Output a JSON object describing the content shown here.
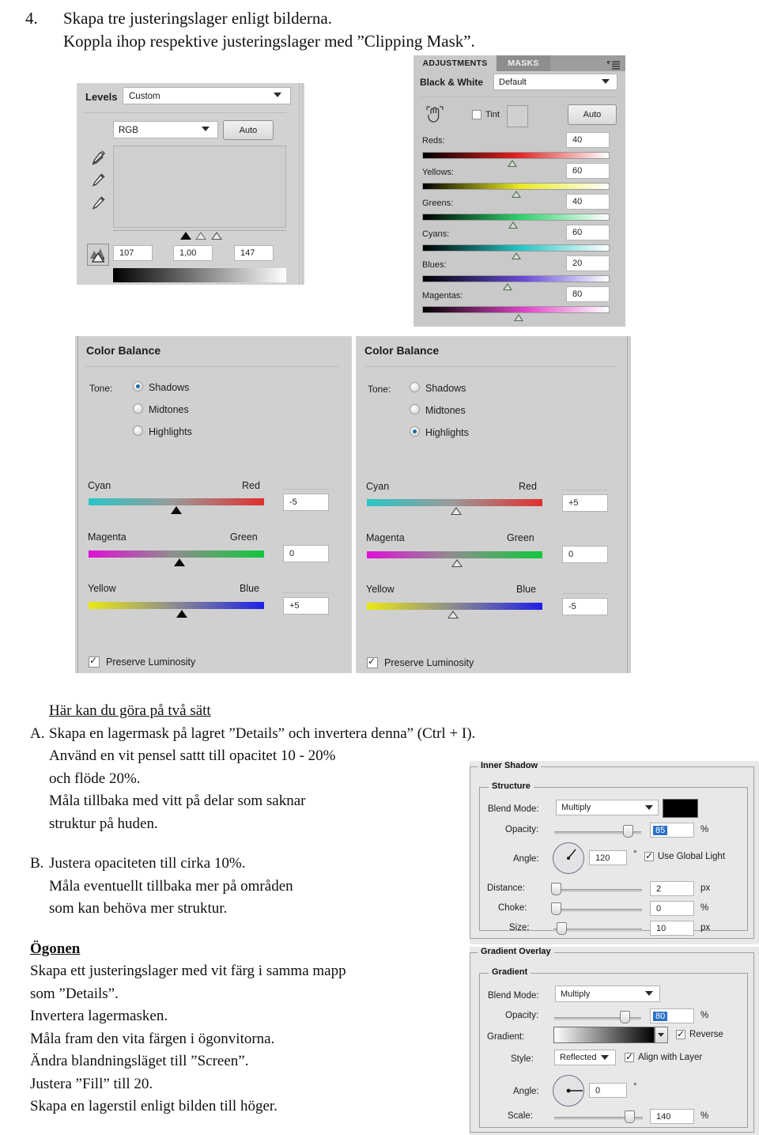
{
  "heading": {
    "number": "4.",
    "line1": "Skapa tre justeringslager enligt bilderna.",
    "line2": "Koppla ihop respektive justeringslager med ”Clipping Mask”."
  },
  "levels_panel": {
    "title": "Levels",
    "preset": "Custom",
    "channel": "RGB",
    "auto_label": "Auto",
    "input_black": "107",
    "gamma": "1,00",
    "input_white": "147",
    "eyedroppers": [
      "black-point-eyedropper",
      "gray-point-eyedropper",
      "white-point-eyedropper"
    ]
  },
  "adjustments_panel": {
    "tabs": [
      {
        "label": "ADJUSTMENTS",
        "active": true
      },
      {
        "label": "MASKS",
        "active": false
      }
    ],
    "menu_icon": "panel-menu-icon",
    "title": "Black & White",
    "preset": "Default",
    "hand_icon": "targeted-adjustment-icon",
    "tint_label": "Tint",
    "tint_checked": false,
    "auto_label": "Auto",
    "sliders": [
      {
        "label": "Reds:",
        "value": "40",
        "color_from": "#000000",
        "color_mid": "#e02020",
        "color_to": "#ffffff"
      },
      {
        "label": "Yellows:",
        "value": "60",
        "color_from": "#000000",
        "color_mid": "#eaea20",
        "color_to": "#ffffff"
      },
      {
        "label": "Greens:",
        "value": "40",
        "color_from": "#000000",
        "color_mid": "#2ad26a",
        "color_to": "#ffffff"
      },
      {
        "label": "Cyans:",
        "value": "60",
        "color_from": "#000000",
        "color_mid": "#24c4c4",
        "color_to": "#ffffff"
      },
      {
        "label": "Blues:",
        "value": "20",
        "color_from": "#000000",
        "color_mid": "#6a4ddb",
        "color_to": "#ffffff"
      },
      {
        "label": "Magentas:",
        "value": "80",
        "color_from": "#000000",
        "color_mid": "#e246c8",
        "color_to": "#ffffff"
      }
    ]
  },
  "color_balance_left": {
    "title": "Color Balance",
    "tone_label": "Tone:",
    "tones": [
      {
        "label": "Shadows",
        "selected": true
      },
      {
        "label": "Midtones",
        "selected": false
      },
      {
        "label": "Highlights",
        "selected": false
      }
    ],
    "sliders": [
      {
        "left_label": "Cyan",
        "right_label": "Red",
        "value": "-5"
      },
      {
        "left_label": "Magenta",
        "right_label": "Green",
        "value": "0"
      },
      {
        "left_label": "Yellow",
        "right_label": "Blue",
        "value": "+5"
      }
    ],
    "preserve_label": "Preserve Luminosity",
    "preserve_checked": true
  },
  "color_balance_right": {
    "title": "Color Balance",
    "tone_label": "Tone:",
    "tones": [
      {
        "label": "Shadows",
        "selected": false
      },
      {
        "label": "Midtones",
        "selected": false
      },
      {
        "label": "Highlights",
        "selected": true
      }
    ],
    "sliders": [
      {
        "left_label": "Cyan",
        "right_label": "Red",
        "value": "+5"
      },
      {
        "left_label": "Magenta",
        "right_label": "Green",
        "value": "0"
      },
      {
        "left_label": "Yellow",
        "right_label": "Blue",
        "value": "-5"
      }
    ],
    "preserve_label": "Preserve Luminosity",
    "preserve_checked": true
  },
  "body_text": {
    "intro_heading": "Här kan du göra på två sätt",
    "a_marker": "A.",
    "a_line1": "Skapa en lagermask på lagret ”Details” och invertera denna” (Ctrl + I).",
    "a_line2": "Använd en vit pensel sattt till opacitet 10 - 20%",
    "a_line3": "och flöde 20%.",
    "a_line4": "Måla tillbaka med vitt på delar som saknar",
    "a_line5": "struktur på huden.",
    "b_marker": "B.",
    "b_line1": "Justera opaciteten till cirka 10%.",
    "b_line2": "Måla eventuellt tillbaka mer på områden",
    "b_line3": "som kan behöva mer struktur.",
    "eyes_heading": "Ögonen",
    "eyes_line1": "Skapa ett justeringslager med vit färg i samma mapp",
    "eyes_line2": "som ”Details”.",
    "eyes_line3": "Invertera lagermasken.",
    "eyes_line4": "Måla fram den vita färgen i ögonvitorna.",
    "eyes_line5": "Ändra blandningsläget till ”Screen”.",
    "eyes_line6": "Justera ”Fill” till 20.",
    "eyes_line7": "Skapa en lagerstil enligt bilden till höger."
  },
  "layer_style": {
    "inner_shadow": {
      "title": "Inner Shadow",
      "structure_title": "Structure",
      "blend_mode_label": "Blend Mode:",
      "blend_mode_value": "Multiply",
      "color_swatch": "#000000",
      "opacity_label": "Opacity:",
      "opacity_value": "85",
      "opacity_unit": "%",
      "angle_label": "Angle:",
      "angle_value": "120",
      "angle_unit": "°",
      "global_light_label": "Use Global Light",
      "global_light_checked": true,
      "distance_label": "Distance:",
      "distance_value": "2",
      "distance_unit": "px",
      "choke_label": "Choke:",
      "choke_value": "0",
      "choke_unit": "%",
      "size_label": "Size:",
      "size_value": "10",
      "size_unit": "px"
    },
    "gradient_overlay": {
      "title": "Gradient Overlay",
      "gradient_title": "Gradient",
      "blend_mode_label": "Blend Mode:",
      "blend_mode_value": "Multiply",
      "opacity_label": "Opacity:",
      "opacity_value": "80",
      "opacity_unit": "%",
      "gradient_label": "Gradient:",
      "reverse_label": "Reverse",
      "reverse_checked": true,
      "style_label": "Style:",
      "style_value": "Reflected",
      "align_label": "Align with Layer",
      "align_checked": true,
      "angle_label": "Angle:",
      "angle_value": "0",
      "angle_unit": "°",
      "scale_label": "Scale:",
      "scale_value": "140",
      "scale_unit": "%"
    }
  }
}
